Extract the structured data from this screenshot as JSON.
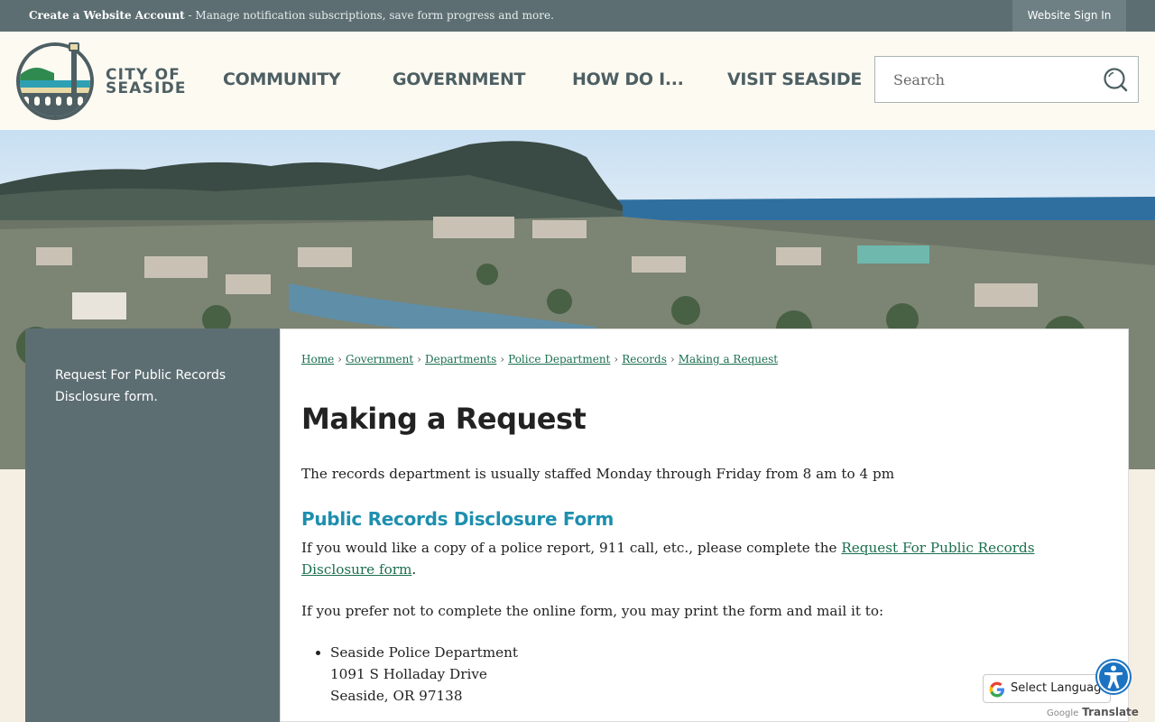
{
  "topbar": {
    "account_link": "Create a Website Account",
    "account_desc": " - Manage notification subscriptions, save form progress and more.",
    "sign_in": "Website Sign In"
  },
  "header": {
    "logo_line1": "CITY OF",
    "logo_line2": "SEASIDE",
    "nav": [
      "COMMUNITY",
      "GOVERNMENT",
      "HOW DO I...",
      "VISIT SEASIDE"
    ],
    "search_placeholder": "Search"
  },
  "sidebar": {
    "link": "Request For Public Records Disclosure form."
  },
  "breadcrumb": [
    "Home",
    "Government",
    "Departments",
    "Police Department",
    "Records",
    "Making a Request"
  ],
  "page": {
    "title": "Making a Request",
    "hours": "The records department is usually staffed Monday through Friday from 8 am to 4 pm",
    "section_title": "Public Records Disclosure Form",
    "para1_before": "If you would like a copy of a police report, 911 call, etc., please complete the ",
    "para1_link": "Request For Public Records Disclosure form",
    "para1_after": ".",
    "para2": "If you prefer not to complete the online form, you may print the form and mail it to:",
    "address": [
      "Seaside Police Department",
      "1091 S Holladay Drive",
      "Seaside, OR 97138"
    ]
  },
  "translate": {
    "select_label": "Select Language",
    "powered_google": "Google",
    "powered_translate": "Translate"
  },
  "colors": {
    "topbar": "#5d6e72",
    "accent_link": "#1b6f4f",
    "section_heading": "#1e8fae",
    "nav_text": "#4d5f63"
  }
}
